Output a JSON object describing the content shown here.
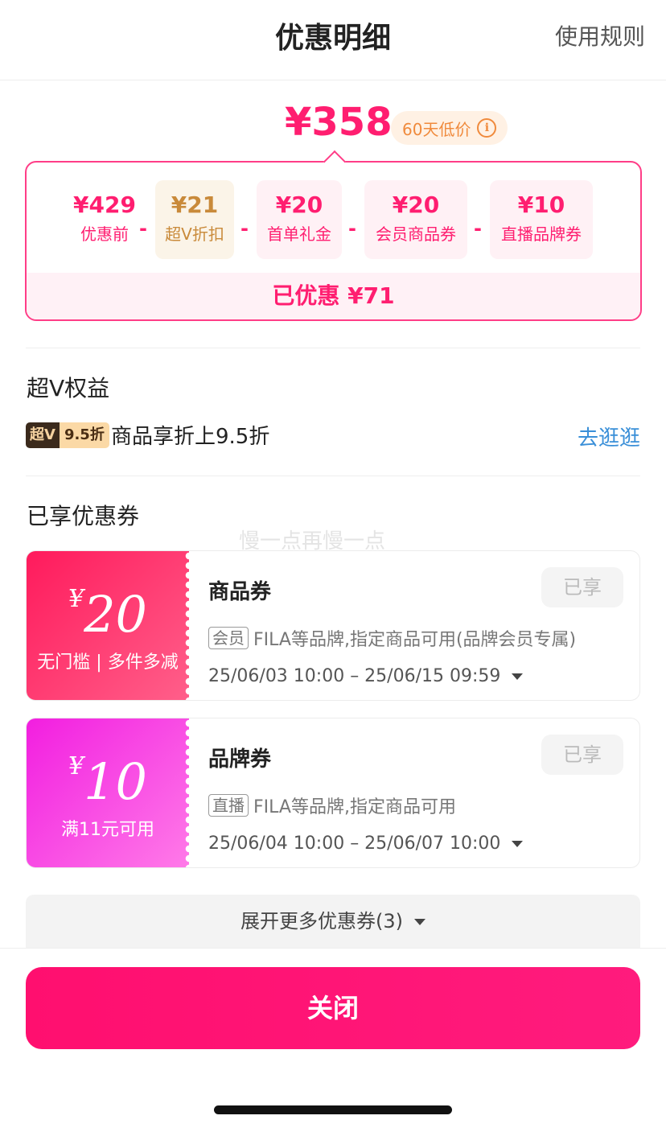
{
  "header": {
    "title": "优惠明细",
    "rules_link": "使用规则"
  },
  "price": {
    "final": "¥358",
    "low_tag": "60天低价",
    "info_icon": "i"
  },
  "breakdown": {
    "items": [
      {
        "amount": "¥429",
        "label": "优惠前"
      },
      {
        "amount": "¥21",
        "label": "超V折扣"
      },
      {
        "amount": "¥20",
        "label": "首单礼金"
      },
      {
        "amount": "¥20",
        "label": "会员商品券"
      },
      {
        "amount": "¥10",
        "label": "直播品牌券"
      }
    ],
    "minus": "-",
    "saved": "已优惠 ¥71"
  },
  "super_v": {
    "section_title": "超V权益",
    "badge_dark": "超V",
    "badge_light": "9.5折",
    "text": "商品享折上9.5折",
    "link": "去逛逛"
  },
  "coupons": {
    "section_title": "已享优惠券",
    "watermark": "慢一点再慢一点",
    "list": [
      {
        "yen": "¥",
        "value": "20",
        "condition": "无门槛 | 多件多减",
        "name": "商品券",
        "status": "已享",
        "tag": "会员",
        "desc": "FILA等品牌,指定商品可用(品牌会员专属)",
        "time": "25/06/03 10:00 – 25/06/15 09:59"
      },
      {
        "yen": "¥",
        "value": "10",
        "condition": "满11元可用",
        "name": "品牌券",
        "status": "已享",
        "tag": "直播",
        "desc": "FILA等品牌,指定商品可用",
        "time": "25/06/04 10:00 – 25/06/07 10:00"
      }
    ],
    "expand": "展开更多优惠券(3)"
  },
  "colors": {
    "accent": "#ff1e70",
    "link": "#3a8fd8",
    "gold": "#c98a3a"
  },
  "footer": {
    "close": "关闭"
  }
}
